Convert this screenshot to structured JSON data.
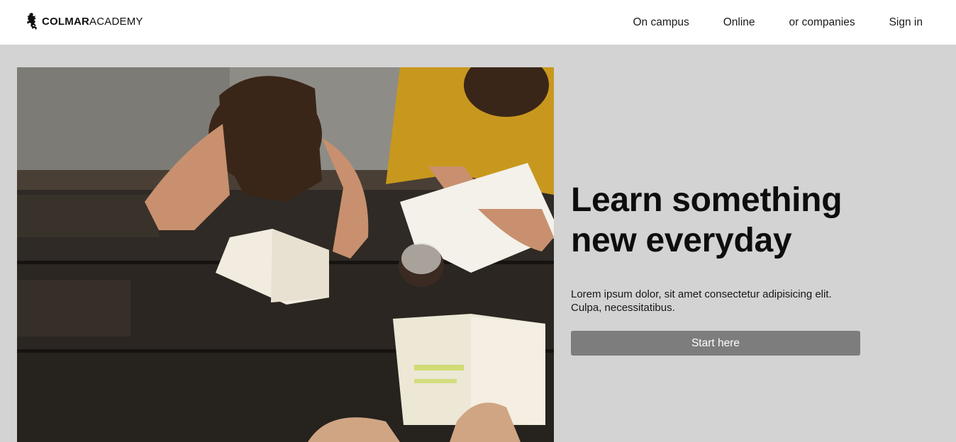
{
  "brand": {
    "name_bold": "COLMAR",
    "name_light": "ACADEMY",
    "logo_icon": "lion-rampant-icon"
  },
  "nav": {
    "items": [
      {
        "label": "On campus"
      },
      {
        "label": "Online"
      },
      {
        "label": "or companies"
      },
      {
        "label": "Sign in"
      }
    ]
  },
  "hero": {
    "image_subject": "students-reading-at-picnic-table",
    "headline_line1": "Learn something",
    "headline_line2": "new everyday",
    "lede_line1": "Lorem ipsum dolor, sit amet consectetur adipisicing elit.",
    "lede_line2": "Culpa, necessitatibus.",
    "cta_label": "Start here"
  },
  "colors": {
    "page_bg": "#d3d3d3",
    "header_bg": "#ffffff",
    "cta_bg": "#7d7d7d",
    "cta_text": "#ffffff",
    "text": "#111111"
  }
}
